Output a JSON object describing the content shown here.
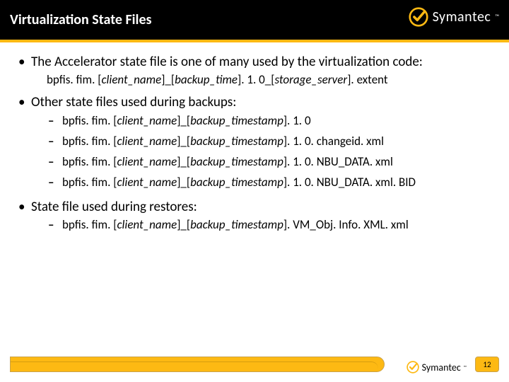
{
  "header": {
    "title": "Virtualization State Files",
    "brand": "Symantec"
  },
  "content": {
    "b1": {
      "text": "The Accelerator state file is one of many used by the virtualization code:",
      "sub_pre": "bpfis. fim. [",
      "sub_i1": "client_name",
      "sub_mid1": "]_[",
      "sub_i2": "backup_time",
      "sub_mid2": "]. 1. 0_[",
      "sub_i3": "storage_server",
      "sub_post": "]. extent"
    },
    "b2": {
      "text": "Other state files used during backups:",
      "items": [
        {
          "pre": "bpfis. fim. [",
          "i1": "client_name",
          "mid": "]_[",
          "i2": "backup_timestamp",
          "post": "]. 1. 0"
        },
        {
          "pre": "bpfis. fim. [",
          "i1": "client_name",
          "mid": "]_[",
          "i2": "backup_timestamp",
          "post": "]. 1. 0. changeid. xml"
        },
        {
          "pre": "bpfis. fim. [",
          "i1": "client_name",
          "mid": "]_[",
          "i2": "backup_timestamp",
          "post": "]. 1. 0. NBU_DATA. xml"
        },
        {
          "pre": "bpfis. fim. [",
          "i1": "client_name",
          "mid": "]_[",
          "i2": "backup_timestamp",
          "post": "]. 1. 0. NBU_DATA. xml. BID"
        }
      ]
    },
    "b3": {
      "text": "State file used during restores:",
      "items": [
        {
          "pre": "bpfis. fim. [",
          "i1": "client_name",
          "mid": "]_[",
          "i2": "backup_timestamp",
          "post": "]. VM_Obj. Info. XML. xml"
        }
      ]
    }
  },
  "footer": {
    "brand": "Symantec",
    "page": "12"
  }
}
